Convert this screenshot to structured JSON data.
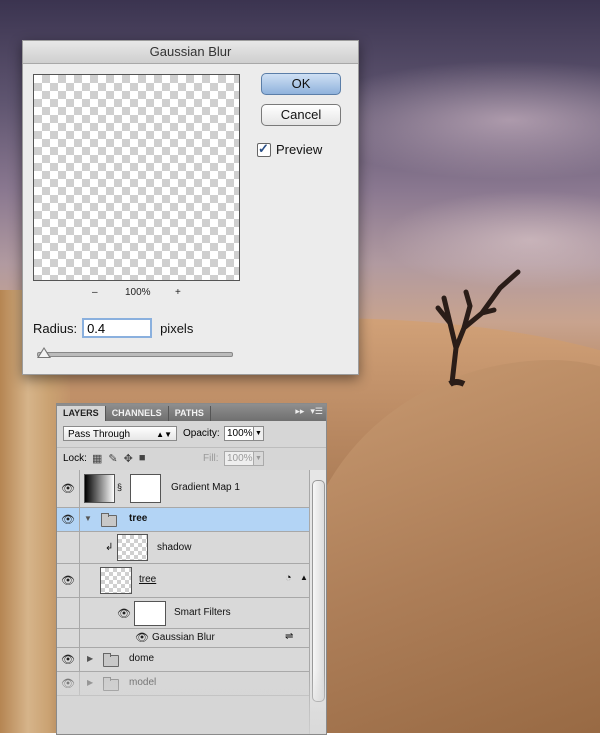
{
  "dialog": {
    "title": "Gaussian Blur",
    "ok_label": "OK",
    "cancel_label": "Cancel",
    "preview_label": "Preview",
    "preview_checked": true,
    "zoom_minus": "–",
    "zoom_level": "100%",
    "zoom_plus": "+",
    "radius_label": "Radius:",
    "radius_value": "0.4",
    "radius_unit": "pixels"
  },
  "layers_panel": {
    "tabs": [
      {
        "label": "LAYERS",
        "active": true
      },
      {
        "label": "CHANNELS",
        "active": false
      },
      {
        "label": "PATHS",
        "active": false
      }
    ],
    "panel_controls": {
      "collapse": "▸▸",
      "menu": "▾☰"
    },
    "blend_mode": "Pass Through",
    "opacity_label": "Opacity:",
    "opacity_value": "100%",
    "lock_label": "Lock:",
    "fill_label": "Fill:",
    "fill_value": "100%",
    "layers": [
      {
        "name": "Gradient Map 1",
        "visible": true
      },
      {
        "name": "tree",
        "visible": true,
        "type": "group",
        "expanded": true,
        "selected": true
      },
      {
        "name": "shadow",
        "visible": false,
        "clipped": true
      },
      {
        "name": "tree",
        "visible": true,
        "type": "smart-object"
      },
      {
        "name": "Smart Filters",
        "visible": true
      },
      {
        "name": "Gaussian Blur",
        "visible": true
      },
      {
        "name": "dome",
        "visible": true,
        "type": "group"
      },
      {
        "name": "model",
        "visible": true,
        "type": "group"
      }
    ]
  },
  "colors": {
    "selected_row": "#b3d4f5",
    "ok_button": "#8fb2dc",
    "radius_focus": "#8ab0de"
  }
}
